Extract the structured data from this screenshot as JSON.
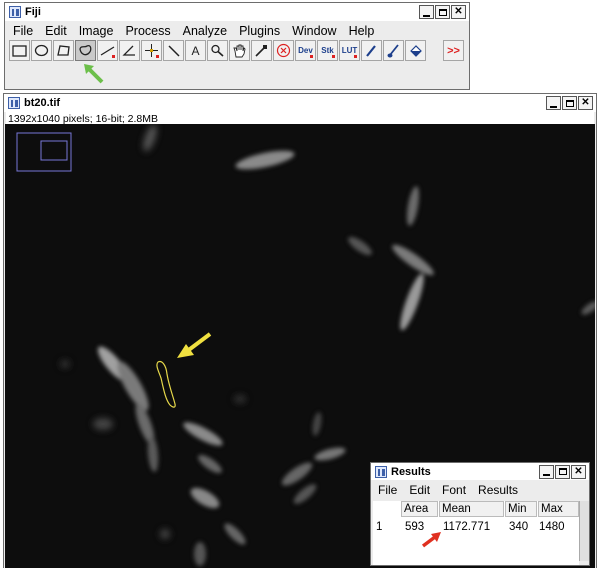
{
  "fiji": {
    "title": "Fiji",
    "menus": [
      "File",
      "Edit",
      "Image",
      "Process",
      "Analyze",
      "Plugins",
      "Window",
      "Help"
    ],
    "tool_labels": {
      "dev": "Dev",
      "stk": "Stk",
      "lut": "LUT",
      "text": "A",
      "more": ">>"
    }
  },
  "image_window": {
    "title": "bt20.tif",
    "info": "1392x1040 pixels; 16-bit; 2.8MB"
  },
  "results": {
    "title": "Results",
    "menus": [
      "File",
      "Edit",
      "Font",
      "Results"
    ],
    "headers": [
      "Area",
      "Mean",
      "Min",
      "Max"
    ],
    "row": {
      "index": "1",
      "area": "593",
      "mean": "1172.771",
      "min": "340",
      "max": "1480"
    }
  },
  "annotation_colors": {
    "green_arrow": "#6cbf4a",
    "yellow_arrow": "#f0e040",
    "red_arrow": "#e03020",
    "roi_outline": "#e6d84a"
  }
}
